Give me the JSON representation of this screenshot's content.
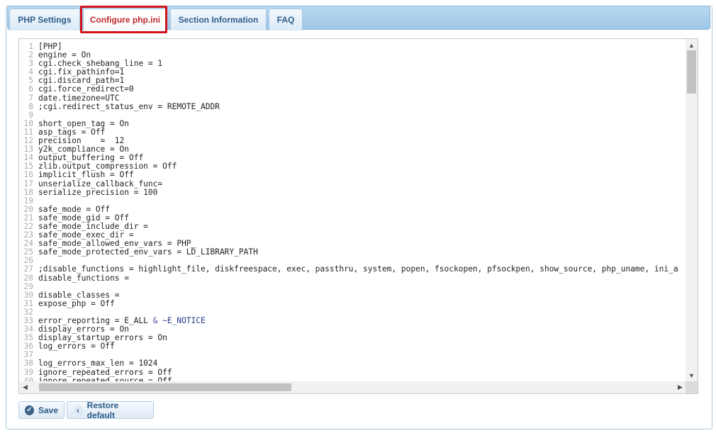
{
  "tabs": [
    {
      "label": "PHP Settings"
    },
    {
      "label": "Configure php.ini"
    },
    {
      "label": "Section Information"
    },
    {
      "label": "FAQ"
    }
  ],
  "editor": {
    "lines": [
      "[PHP]",
      "engine = On",
      "cgi.check_shebang_line = 1",
      "cgi.fix_pathinfo=1",
      "cgi.discard_path=1",
      "cgi.force_redirect=0",
      "date.timezone=UTC",
      ";cgi.redirect_status_env = REMOTE_ADDR",
      "",
      "short_open_tag = On",
      "asp_tags = Off",
      "precision    =  12",
      "y2k_compliance = On",
      "output_buffering = Off",
      "zlib.output_compression = Off",
      "implicit_flush = Off",
      "unserialize_callback_func=",
      "serialize_precision = 100",
      "",
      "safe_mode = Off",
      "safe_mode_gid = Off",
      "safe_mode_include_dir =",
      "safe_mode_exec_dir =",
      "safe_mode_allowed_env_vars = PHP_",
      "safe_mode_protected_env_vars = LD_LIBRARY_PATH",
      "",
      ";disable_functions = highlight_file, diskfreespace, exec, passthru, system, popen, fsockopen, pfsockpen, show_source, php_uname, ini_alter, ini_restore",
      "disable_functions =",
      "",
      "disable_classes =",
      "expose_php = Off",
      "",
      "error_reporting = E_ALL & ~E_NOTICE",
      "display_errors = On",
      "display_startup_errors = On",
      "log_errors = Off",
      "",
      "log_errors_max_len = 1024",
      "ignore_repeated_errors = Off",
      "ignore_repeated_source = Off"
    ]
  },
  "buttons": {
    "save": "Save",
    "restore": "Restore default"
  },
  "icons": {
    "save": "check-circle-icon",
    "restore": "chevron-left-icon"
  },
  "colors": {
    "active_tab_text": "#c0282d",
    "highlight_border": "#d0121b",
    "tab_text": "#2c5c8a"
  }
}
